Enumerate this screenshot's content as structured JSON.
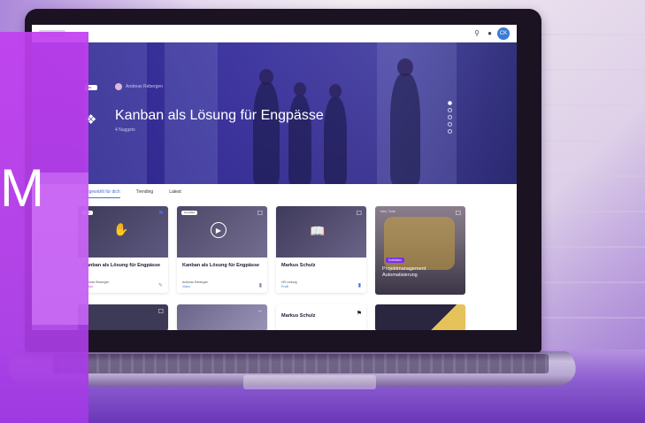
{
  "brand": {
    "letter": "M"
  },
  "topbar": {
    "search_icon": "search-icon",
    "bell_icon": "bell-icon",
    "avatar_initials": "CK"
  },
  "hero": {
    "badge": "Neu",
    "author": "Andreas Rebergen",
    "title": "Kanban als Lösung für Engpässe",
    "subtitle": "4 Nuggets",
    "icon": "stack-icon",
    "dots": 5
  },
  "tabs": [
    {
      "label": "Ausgewählt für dich",
      "active": true
    },
    {
      "label": "Trending",
      "active": false
    },
    {
      "label": "Latest",
      "active": false
    }
  ],
  "cards": [
    {
      "title": "Kanban als Lösung für Engpässe",
      "chip": "Neu",
      "meta": "Andreas Rebergen",
      "meta2": "Lektion",
      "icon": "hand-icon"
    },
    {
      "title": "Kanban als Lösung für Engpässe",
      "chip": "Lernpfad",
      "meta": "Andreas Rebergen",
      "meta2": "Video",
      "icon": "play-icon"
    },
    {
      "title": "Markus Schulz",
      "chip": "",
      "meta": "HR Leitung",
      "meta2": "Profil",
      "icon": "book-icon"
    },
    {
      "title": "Projektmanagement Automatisierung",
      "chip": "Kollektion",
      "top_text": "Intro, Tools",
      "icon": "robot-image"
    }
  ],
  "cards_row2": [
    {
      "title": ""
    },
    {
      "title": ""
    },
    {
      "title": "Markus Schulz"
    },
    {
      "title": ""
    }
  ],
  "colors": {
    "accent": "#4a6cd6",
    "brand": "#b43ee8",
    "hero": "#2d2a8c"
  }
}
